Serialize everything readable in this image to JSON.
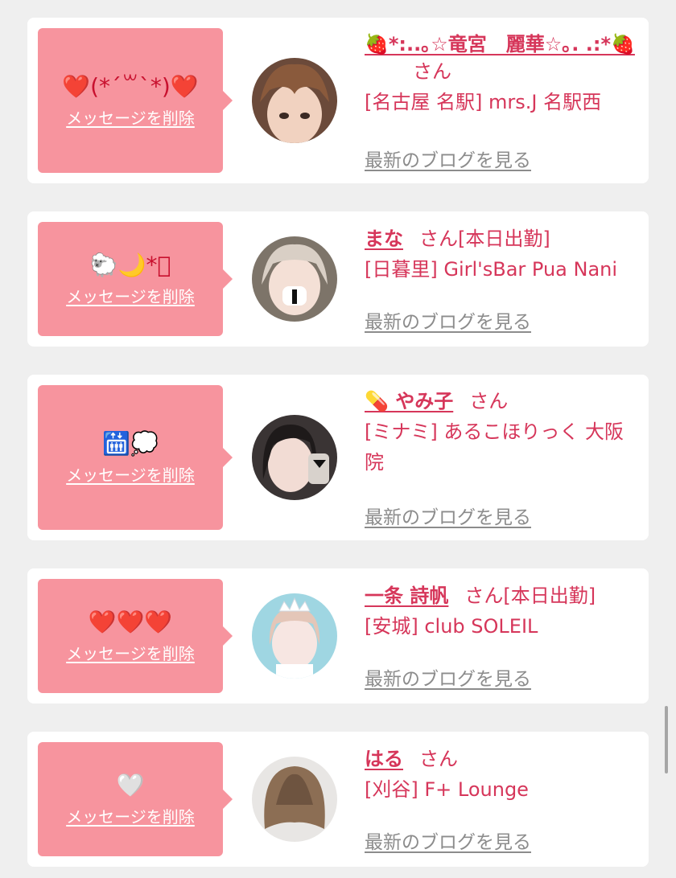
{
  "colors": {
    "accent": "#d6365a",
    "bubble": "#f7949e",
    "background": "#efefef"
  },
  "delete_label": "メッセージを削除",
  "blog_label": "最新のブログを見る",
  "san_suffix": "さん",
  "cards": [
    {
      "message": "❤️(*´꒳`*)❤️",
      "name": "🍓*:..｡☆竜宮　麗華☆｡. .:*🍓",
      "status": "",
      "shop": "[名古屋 名駅] mrs.J 名駅西",
      "avatar": "avatar-woman-brown-bangs"
    },
    {
      "message": "🐑🌙*ﾟ",
      "name": "まな",
      "status": "[本日出勤]",
      "shop": "[日暮里] Girl'sBar Pua Nani",
      "avatar": "avatar-woman-with-mask"
    },
    {
      "message": "🛗💭",
      "name": "💊 やみ子",
      "status": "",
      "shop": "[ミナミ] あるこほりっく 大阪院",
      "avatar": "avatar-woman-dark-hair"
    },
    {
      "message": "❤️❤️❤️",
      "name": "一条 詩帆",
      "status": "[本日出勤]",
      "shop": "[安城] club SOLEIL",
      "avatar": "avatar-woman-tiara"
    },
    {
      "message": "🤍",
      "name": "はる",
      "status": "",
      "shop": "[刈谷] F+ Lounge",
      "avatar": "avatar-short-bob-hair"
    }
  ]
}
